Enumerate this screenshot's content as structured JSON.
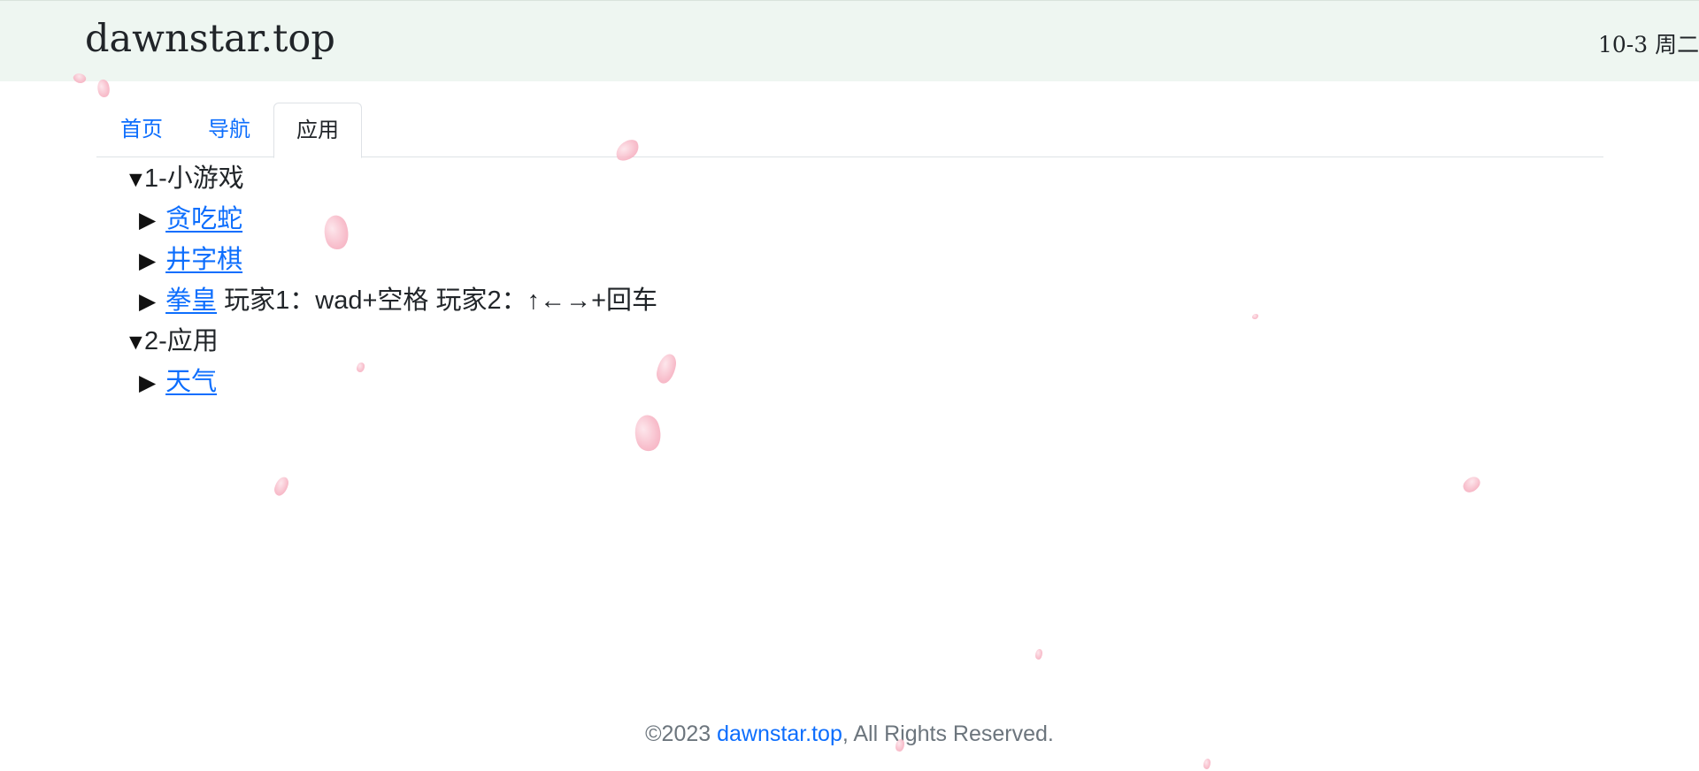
{
  "header": {
    "site_title": "dawnstar.top",
    "date": "10-3 周二"
  },
  "tabs": [
    {
      "label": "首页",
      "active": false
    },
    {
      "label": "导航",
      "active": false
    },
    {
      "label": "应用",
      "active": true
    }
  ],
  "tree": {
    "groups": [
      {
        "label": "1-小游戏",
        "expanded": true,
        "items": [
          {
            "link": "贪吃蛇",
            "note": ""
          },
          {
            "link": "井字棋",
            "note": ""
          },
          {
            "link": "拳皇",
            "note": "玩家1：wad+空格 玩家2：↑←→+回车"
          }
        ]
      },
      {
        "label": "2-应用",
        "expanded": true,
        "items": [
          {
            "link": "天气",
            "note": ""
          }
        ]
      }
    ],
    "marker_expanded": "▼",
    "marker_collapsed": "▶"
  },
  "footer": {
    "prefix": "©2023 ",
    "link": "dawnstar.top",
    "suffix": ", All Rights Reserved."
  },
  "colors": {
    "header_bg": "#eef6f1",
    "link": "#0d6efd",
    "petal": "#f7b7c6"
  }
}
